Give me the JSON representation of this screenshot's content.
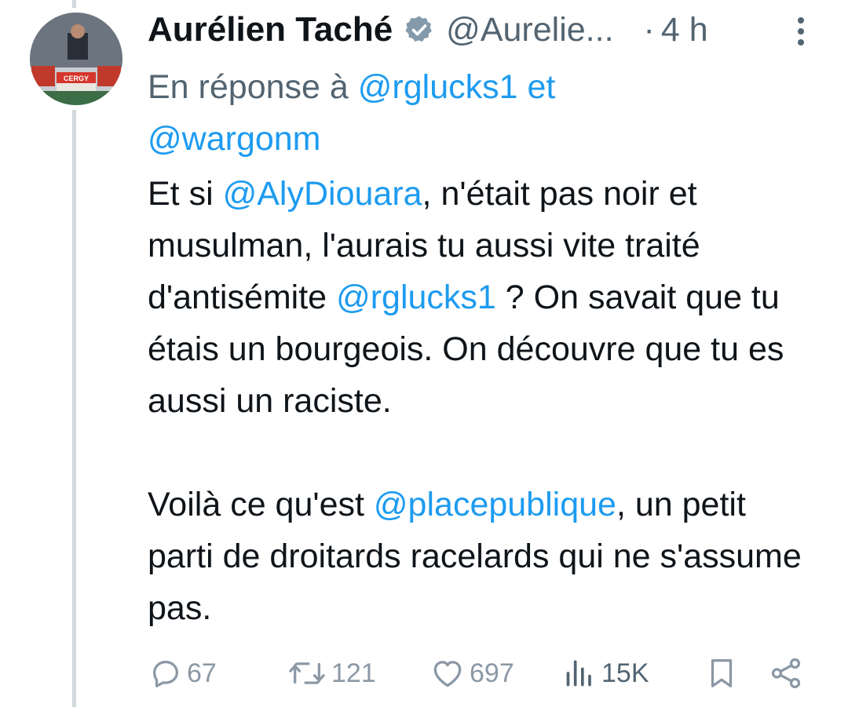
{
  "tweet": {
    "author_name": "Aurélien Taché",
    "handle": "@Aurelie...",
    "separator": "·",
    "time": "4 h",
    "verified": true,
    "avatar_sign": "CERGY",
    "reply_prefix": "En réponse à",
    "reply_user_1": "@rglucks1",
    "reply_and": "et",
    "reply_user_2": "@wargonm",
    "body": {
      "p1_before_mention": "Et si ",
      "mention_1": "@AlyDiouara",
      "p1_mid": ", n'était pas noir et musulman, l'aurais tu aussi vite traité d'antisémite ",
      "mention_2": "@rglucks1",
      "p1_after": " ? On savait que tu étais un bourgeois. On découvre que tu es aussi un raciste.",
      "p2_before_mention": "Voilà ce qu'est ",
      "mention_3": "@placepublique",
      "p2_after": ", un petit parti de droitards racelards qui ne s'assume pas."
    }
  },
  "actions": {
    "replies": "67",
    "reposts": "121",
    "likes": "697",
    "views": "15K"
  },
  "icons": {
    "reply": "reply-icon",
    "repost": "repost-icon",
    "like": "heart-icon",
    "views": "views-icon",
    "bookmark": "bookmark-icon",
    "share": "share-icon",
    "more": "more-icon",
    "verified": "verified-badge-icon"
  },
  "colors": {
    "link": "#1d9bf0",
    "secondary_text": "#536471",
    "action_icon": "#8b98a5",
    "thread_line": "#cfd9de",
    "verified_badge": "#829aab"
  }
}
